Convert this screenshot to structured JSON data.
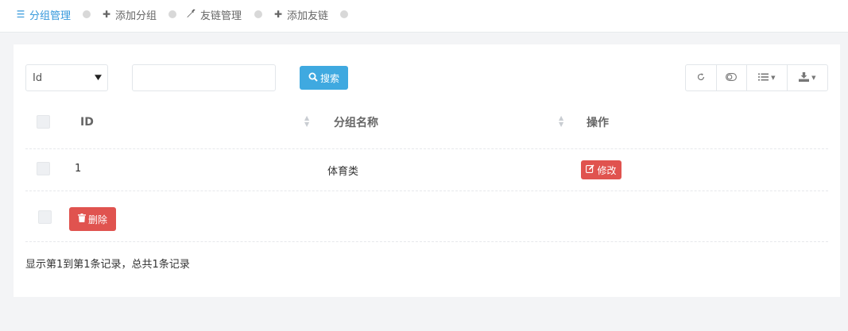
{
  "colors": {
    "accent": "#3498db",
    "search_button": "#3fa9e0",
    "danger": "#e0534f"
  },
  "nav": {
    "tabs": [
      {
        "label": "分组管理",
        "icon": "list-icon",
        "active": true
      },
      {
        "label": "添加分组",
        "icon": "plus-icon",
        "active": false
      },
      {
        "label": "友链管理",
        "icon": "wrench-icon",
        "active": false
      },
      {
        "label": "添加友链",
        "icon": "plus-icon",
        "active": false
      }
    ]
  },
  "toolbar": {
    "field_select": {
      "selected": "Id"
    },
    "search_input": {
      "value": "",
      "placeholder": ""
    },
    "search_button": "搜索",
    "right_tools": [
      "refresh-icon",
      "toggle-icon",
      "columns-icon",
      "export-icon"
    ]
  },
  "table": {
    "columns": [
      "ID",
      "分组名称",
      "操作"
    ],
    "rows": [
      {
        "id": "1",
        "name": "体育类",
        "action": "修改"
      }
    ],
    "bulk_delete": "删除"
  },
  "pagination": {
    "info": "显示第1到第1条记录，总共1条记录"
  }
}
